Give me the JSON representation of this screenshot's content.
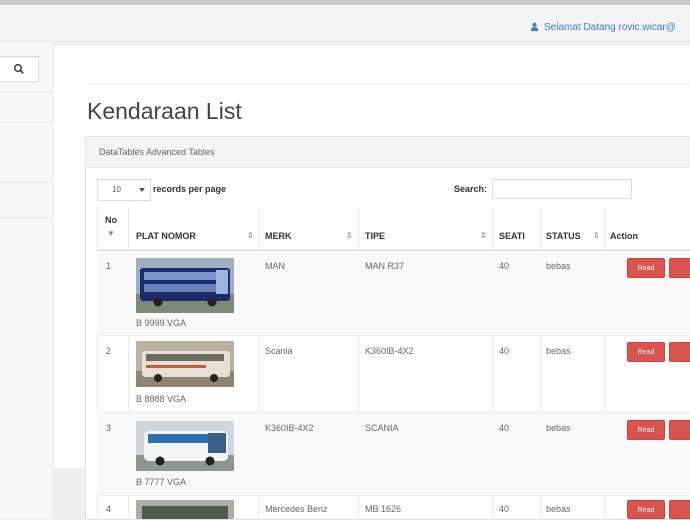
{
  "header": {
    "user_label": "Selamat Datang rovic.wicar@"
  },
  "sidebar": {
    "search_icon": "search-icon"
  },
  "page": {
    "title": "Kendaraan List"
  },
  "table_box": {
    "title": "DataTables Advanced Tables",
    "length_value": "10",
    "length_label": "records per page",
    "search_label": "Search:",
    "search_value": ""
  },
  "table": {
    "headers": {
      "no": "No",
      "plat": "PLAT NOMOR",
      "merk": "MERK",
      "tipe": "TIPE",
      "seat": "SEATI",
      "status": "STATUS",
      "action": "Action"
    },
    "rows": [
      {
        "no": "1",
        "plat": "B 9999 VGA",
        "merk": "MAN",
        "tipe": "MAN R37",
        "seat": "40",
        "status": "bebas",
        "read": "Read",
        "image": "blue-double-decker-bus"
      },
      {
        "no": "2",
        "plat": "B 8888 VGA",
        "merk": "Scania",
        "tipe": "K360IB-4X2",
        "seat": "40",
        "status": "bebas",
        "read": "Read",
        "image": "white-coach-bus"
      },
      {
        "no": "3",
        "plat": "B 7777 VGA",
        "merk": "K360IB-4X2",
        "tipe": "SCANIA",
        "seat": "40",
        "status": "bebas",
        "read": "Read",
        "image": "blue-white-coach-bus"
      },
      {
        "no": "4",
        "plat": "",
        "merk": "Mercedes Benz",
        "tipe": "MB 1626",
        "seat": "40",
        "status": "bebas",
        "read": "Read",
        "image": "coach-bus"
      }
    ]
  },
  "colors": {
    "accent": "#3a7bd5",
    "danger": "#d9534f"
  }
}
